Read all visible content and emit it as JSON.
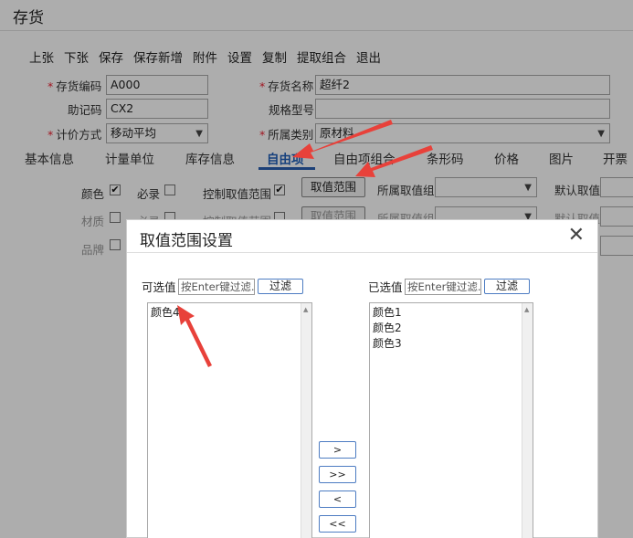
{
  "window": {
    "title": "存货"
  },
  "toolbar": [
    "上张",
    "下张",
    "保存",
    "保存新增",
    "附件",
    "设置",
    "复制",
    "提取组合",
    "退出"
  ],
  "form": {
    "code_label": "存货编码",
    "code_value": "A000",
    "name_label": "存货名称",
    "name_value": "超纤2",
    "mnemonic_label": "助记码",
    "mnemonic_value": "CX2",
    "spec_label": "规格型号",
    "spec_value": "",
    "pricing_label": "计价方式",
    "pricing_value": "移动平均",
    "category_label": "所属类别",
    "category_value": "原材料"
  },
  "tabs": [
    "基本信息",
    "计量单位",
    "库存信息",
    "自由项",
    "自由项组合",
    "条形码",
    "价格",
    "图片",
    "开票"
  ],
  "active_tab": "自由项",
  "free_rows": [
    {
      "name": "颜色",
      "required": "必录",
      "control": "控制取值范围",
      "range_btn": "取值范围",
      "group": "所属取值组",
      "default": "默认取值"
    },
    {
      "name": "材质",
      "required": "必录",
      "control": "控制取值范围",
      "range_btn": "取值范围",
      "group": "所属取值组",
      "default": "默认取值"
    },
    {
      "name": "品牌"
    }
  ],
  "dialog": {
    "title": "取值范围设置",
    "close": "✕",
    "available_label": "可选值",
    "selected_label": "已选值",
    "filter_placeholder": "按Enter键过滤.",
    "filter_btn": "过滤",
    "available_items": [
      "颜色4"
    ],
    "selected_items": [
      "颜色1",
      "颜色2",
      "颜色3"
    ],
    "move_buttons": [
      ">",
      ">>",
      "<",
      "<<"
    ]
  },
  "colors": {
    "accent": "#1f5fb8",
    "annotation_arrow": "#e8413a",
    "required": "#e22233"
  }
}
